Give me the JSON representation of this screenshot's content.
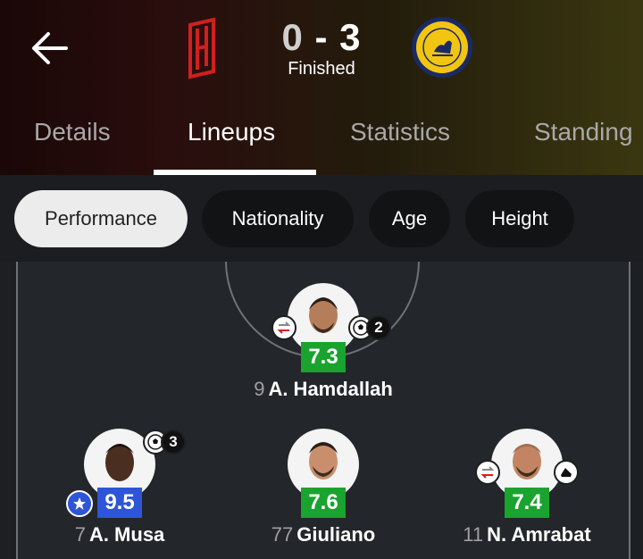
{
  "header": {
    "score_home": "0",
    "score_separator": "-",
    "score_away": "3",
    "status": "Finished"
  },
  "tabs": [
    "Details",
    "Lineups",
    "Statistics",
    "Standing"
  ],
  "filters": [
    "Performance",
    "Nationality",
    "Age",
    "Height"
  ],
  "players": [
    {
      "number": "9",
      "name": "A. Hamdallah",
      "rating": "7.3",
      "goals": "2",
      "subbed": true
    },
    {
      "number": "7",
      "name": "A. Musa",
      "rating": "9.5",
      "goals": "3",
      "star": true
    },
    {
      "number": "77",
      "name": "Giuliano",
      "rating": "7.6"
    },
    {
      "number": "11",
      "name": "N. Amrabat",
      "rating": "7.4",
      "subbed": true,
      "assist": true
    }
  ],
  "colors": {
    "rating_green": "#1aa32f",
    "rating_blue": "#2e55d8",
    "home_red": "#d11f1f",
    "away_yellow": "#f2c513",
    "away_navy": "#1a2a66"
  }
}
